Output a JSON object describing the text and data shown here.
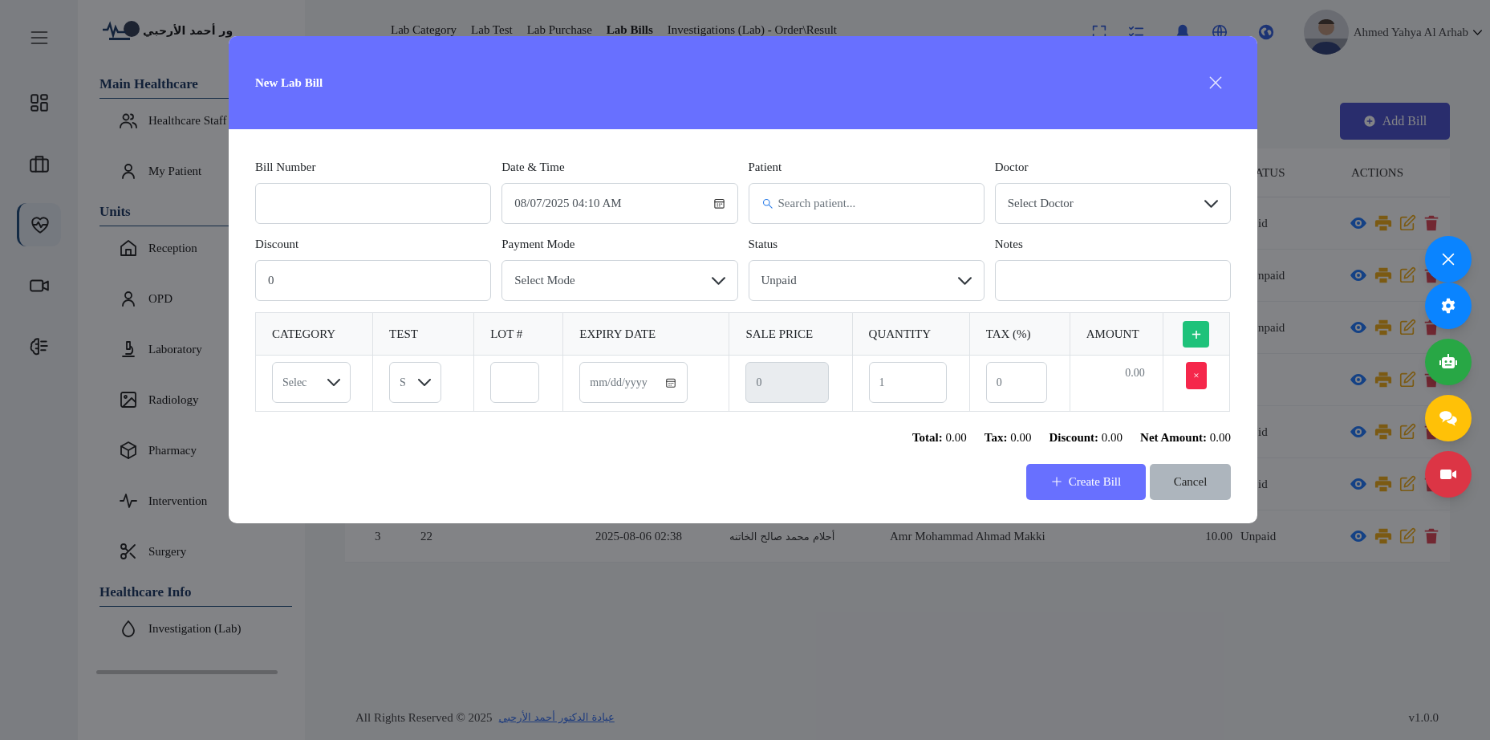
{
  "rail": {
    "items": [
      {
        "selected": false
      },
      {
        "selected": false
      },
      {
        "selected": true
      },
      {
        "selected": false
      },
      {
        "selected": false
      }
    ]
  },
  "sidebar": {
    "logo_text": "ور أحمد الأرحبي",
    "sections": [
      {
        "title": "Main Healthcare",
        "items": [
          {
            "label": "Healthcare Staff"
          },
          {
            "label": "My Patient"
          }
        ]
      },
      {
        "title": "Units",
        "items": [
          {
            "label": "Reception"
          },
          {
            "label": "OPD"
          },
          {
            "label": "Laboratory"
          },
          {
            "label": "Radiology"
          },
          {
            "label": "Pharmacy"
          },
          {
            "label": "Intervention"
          },
          {
            "label": "Surgery"
          }
        ]
      },
      {
        "title": "Healthcare Info",
        "items": [
          {
            "label": "Investigation (Lab)"
          }
        ]
      }
    ]
  },
  "top_nav": {
    "links": [
      {
        "label": "Lab Category",
        "selected": false
      },
      {
        "label": "Lab Test",
        "selected": false
      },
      {
        "label": "Lab Purchase",
        "selected": false
      },
      {
        "label": "Lab Bills",
        "selected": true
      },
      {
        "label": "Investigations (Lab) - Order\\Result",
        "selected": false
      }
    ],
    "user_name": "Ahmed Yahya Al Arhab"
  },
  "page": {
    "add_button": "Add Bill",
    "table": {
      "columns": [
        "ATUS",
        "ACTIONS"
      ],
      "rows": [
        {
          "status": "id"
        },
        {
          "status": "npaid"
        },
        {
          "status": "npaid"
        },
        {},
        {
          "status": "id"
        },
        {
          "status": "id"
        },
        {
          "cells": [
            "3",
            "22",
            "2025-08-06 02:38",
            "أحلام محمد صالح الخاتنه",
            "Amr Mohammad Ahmad Makki",
            "10.00"
          ],
          "status": "Unpaid"
        }
      ]
    }
  },
  "footer": {
    "copyright": "All Rights Reserved © 2025",
    "link": "عيادة الدكتور أحمد الأرحبي",
    "version": "v1.0.0"
  },
  "modal": {
    "title": "New Lab Bill",
    "fields": [
      {
        "label": "Bill Number",
        "kind": "text"
      },
      {
        "label": "Date & Time",
        "kind": "datetime",
        "value": "08/07/2025 04:10 AM"
      },
      {
        "label": "Patient",
        "kind": "search",
        "placeholder": "Search patient..."
      },
      {
        "label": "Doctor",
        "kind": "select",
        "value": "Select Doctor"
      },
      {
        "label": "Discount",
        "kind": "text",
        "value": "0"
      },
      {
        "label": "Payment Mode",
        "kind": "select",
        "value": "Select Mode"
      },
      {
        "label": "Status",
        "kind": "select",
        "value": "Unpaid"
      },
      {
        "label": "Notes",
        "kind": "text"
      }
    ],
    "items_table": {
      "columns": [
        "CATEGORY",
        "TEST",
        "LOT #",
        "EXPIRY DATE",
        "SALE PRICE",
        "QUANTITY",
        "TAX (%)",
        "AMOUNT"
      ],
      "add_button": "+",
      "rows": [
        {
          "cells": [
            {
              "kind": "select",
              "value": "Selec"
            },
            {
              "kind": "select",
              "value": "S"
            },
            {
              "kind": "input",
              "disabled": false
            },
            {
              "kind": "date",
              "placeholder": "mm/dd/yyyy"
            },
            {
              "kind": "input",
              "value": "0",
              "disabled": true
            },
            {
              "kind": "input",
              "value": "1",
              "disabled": false
            },
            {
              "kind": "input",
              "value": "0",
              "disabled": false
            },
            {
              "kind": "text",
              "value": "0.00"
            }
          ],
          "remove_button": "×"
        }
      ]
    },
    "totals": [
      "**Total:** 0.00",
      "**Tax:** 0.00",
      "**Discount:** 0.00",
      "**Net Amount:** 0.00"
    ],
    "buttons": [
      {
        "label": "Create Bill",
        "kind": "primary"
      },
      {
        "label": "Cancel",
        "kind": "secondary"
      }
    ]
  },
  "fab": [
    {
      "kind": "close",
      "color": "#0a84ff"
    },
    {
      "kind": "settings",
      "color": "#0a84ff"
    },
    {
      "kind": "robot",
      "color": "#28a745"
    },
    {
      "kind": "chat",
      "color": "#ffc107"
    },
    {
      "kind": "video",
      "color": "#dc3545"
    }
  ]
}
